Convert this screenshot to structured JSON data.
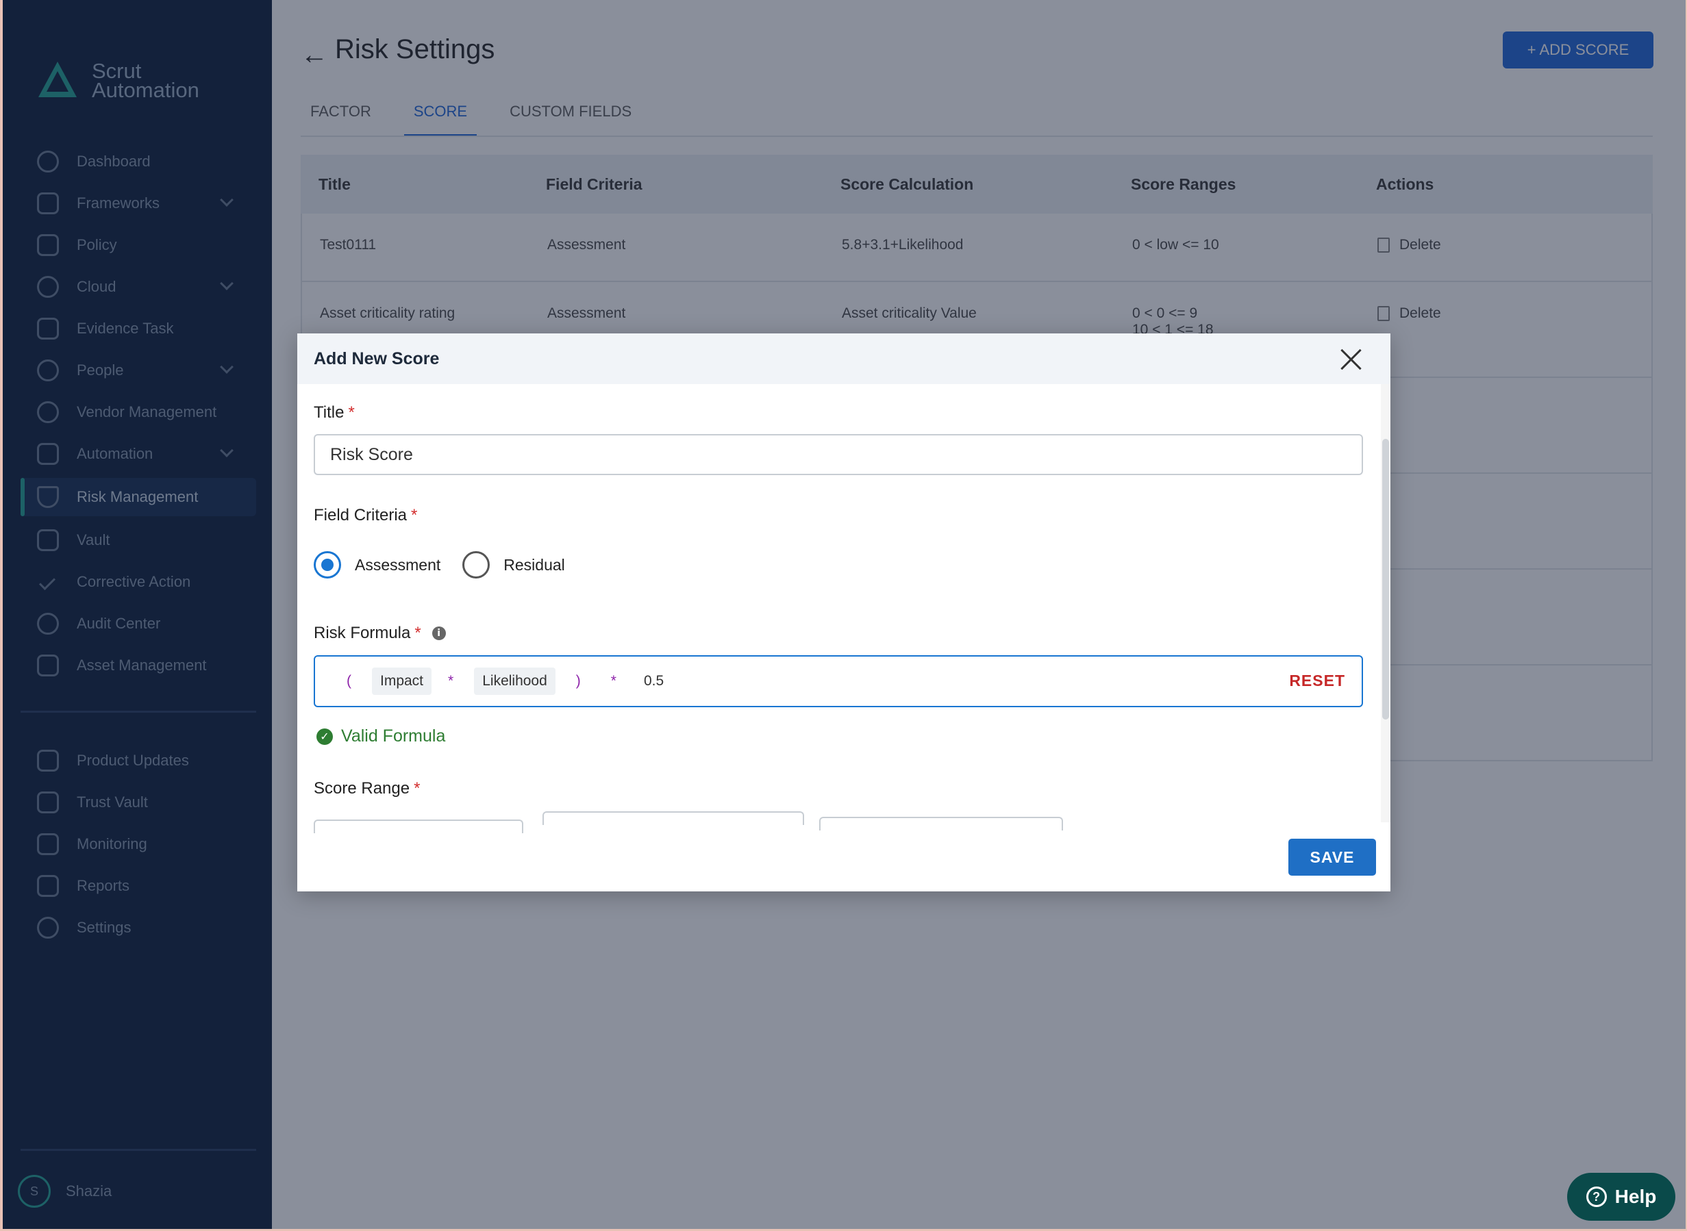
{
  "sidebar": {
    "brand": [
      "Scrut",
      "Automation"
    ],
    "items": [
      {
        "label": "Dashboard",
        "chev": false
      },
      {
        "label": "Frameworks",
        "chev": true
      },
      {
        "label": "Policy",
        "chev": false
      },
      {
        "label": "Cloud",
        "chev": true
      },
      {
        "label": "Evidence Task",
        "chev": false
      },
      {
        "label": "People",
        "chev": true
      },
      {
        "label": "Vendor Management",
        "chev": false
      },
      {
        "label": "Automation",
        "chev": true
      },
      {
        "label": "Risk Management",
        "chev": false
      },
      {
        "label": "Vault",
        "chev": false
      },
      {
        "label": "Corrective Action",
        "chev": false
      },
      {
        "label": "Audit Center",
        "chev": false
      },
      {
        "label": "Asset Management",
        "chev": false
      }
    ],
    "secondary": [
      {
        "label": "Product Updates"
      },
      {
        "label": "Trust Vault"
      },
      {
        "label": "Monitoring"
      },
      {
        "label": "Reports"
      },
      {
        "label": "Settings"
      }
    ],
    "user": {
      "initial": "S",
      "name": "Shazia"
    }
  },
  "header": {
    "title": "Risk Settings",
    "add_button": "+ ADD SCORE"
  },
  "tabs": [
    {
      "label": "FACTOR"
    },
    {
      "label": "SCORE"
    },
    {
      "label": "CUSTOM FIELDS"
    }
  ],
  "table": {
    "columns": [
      "Title",
      "Field Criteria",
      "Score Calculation",
      "Score Ranges",
      "Actions"
    ],
    "rows": [
      {
        "title": "Test0111",
        "criteria": "Assessment",
        "calc": "5.8+3.1+Likelihood",
        "ranges": "0 < low <= 10",
        "action": "Delete"
      },
      {
        "title": "Asset criticality rating",
        "criteria": "Assessment",
        "calc": "Asset criticality Value",
        "ranges": "0 < 0 <= 9",
        "ranges2": "10 < 1 <= 18",
        "action": "Delete"
      }
    ]
  },
  "modal": {
    "title": "Add New Score",
    "title_label": "Title",
    "title_value": "Risk Score",
    "criteria_label": "Field Criteria",
    "criteria_options": [
      "Assessment",
      "Residual"
    ],
    "formula_label": "Risk Formula",
    "formula_tokens": {
      "open": "(",
      "impact": "Impact",
      "times1": "*",
      "likelihood": "Likelihood",
      "close": ")",
      "times2": "*",
      "number": "0.5"
    },
    "reset_label": "RESET",
    "valid_text": "Valid Formula",
    "range_label": "Score Range",
    "save_label": "SAVE"
  },
  "help": {
    "label": "Help"
  },
  "colors": {
    "primary": "#1f6fc5",
    "required": "#d32f2f",
    "valid": "#2e7d32",
    "reset": "#c62828",
    "operator": "#8e24aa"
  }
}
